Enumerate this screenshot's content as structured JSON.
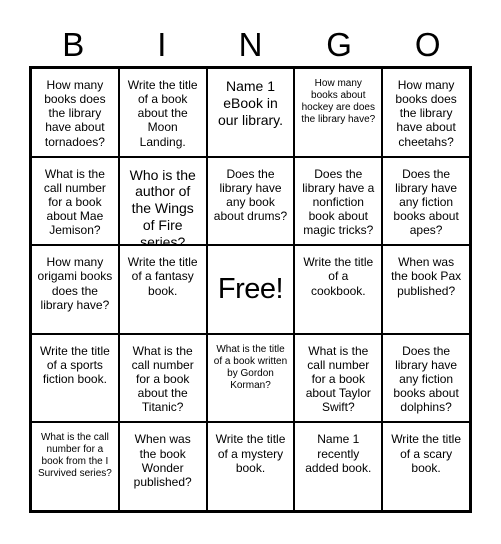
{
  "card": {
    "header_letters": [
      "B",
      "I",
      "N",
      "G",
      "O"
    ],
    "columns": 5,
    "rows": 5,
    "border_color": "#000000",
    "background_color": "#ffffff",
    "text_color": "#000000"
  },
  "cells": [
    {
      "text": "How many books does the library have about tornadoes?",
      "size": "md",
      "free": false
    },
    {
      "text": "Write the title of a book about the Moon Landing.",
      "size": "md",
      "free": false
    },
    {
      "text": "Name 1 eBook in our library.",
      "size": "lg",
      "free": false
    },
    {
      "text": "How many books about hockey are does the library have?",
      "size": "sm",
      "free": false
    },
    {
      "text": "How many books does the library have about cheetahs?",
      "size": "md",
      "free": false
    },
    {
      "text": "What is the call number for a book about Mae Jemison?",
      "size": "md",
      "free": false
    },
    {
      "text": "Who is the author of the Wings of Fire series?",
      "size": "lg",
      "free": false
    },
    {
      "text": "Does the library have any book about drums?",
      "size": "md",
      "free": false
    },
    {
      "text": "Does the library have a nonfiction book about magic tricks?",
      "size": "md",
      "free": false
    },
    {
      "text": "Does the library have any fiction books about apes?",
      "size": "md",
      "free": false
    },
    {
      "text": "How many origami books does the library have?",
      "size": "md",
      "free": false
    },
    {
      "text": "Write the title of a fantasy book.",
      "size": "md",
      "free": false
    },
    {
      "text": "Free!",
      "size": "lg",
      "free": true
    },
    {
      "text": "Write the title of a cookbook.",
      "size": "md",
      "free": false
    },
    {
      "text": "When was the book Pax published?",
      "size": "md",
      "free": false
    },
    {
      "text": "Write the title of a sports fiction book.",
      "size": "md",
      "free": false
    },
    {
      "text": "What is the call number for a book about the Titanic?",
      "size": "md",
      "free": false
    },
    {
      "text": "What is the title of a book written by Gordon Korman?",
      "size": "sm",
      "free": false
    },
    {
      "text": "What is the call number for a book about Taylor Swift?",
      "size": "md",
      "free": false
    },
    {
      "text": "Does the library have any fiction books about dolphins?",
      "size": "md",
      "free": false
    },
    {
      "text": "What is the call number for a book from the I Survived series?",
      "size": "sm",
      "free": false
    },
    {
      "text": "When was the book Wonder published?",
      "size": "md",
      "free": false
    },
    {
      "text": "Write the title of a mystery book.",
      "size": "md",
      "free": false
    },
    {
      "text": "Name 1 recently added book.",
      "size": "md",
      "free": false
    },
    {
      "text": "Write the title of a scary book.",
      "size": "md",
      "free": false
    }
  ]
}
